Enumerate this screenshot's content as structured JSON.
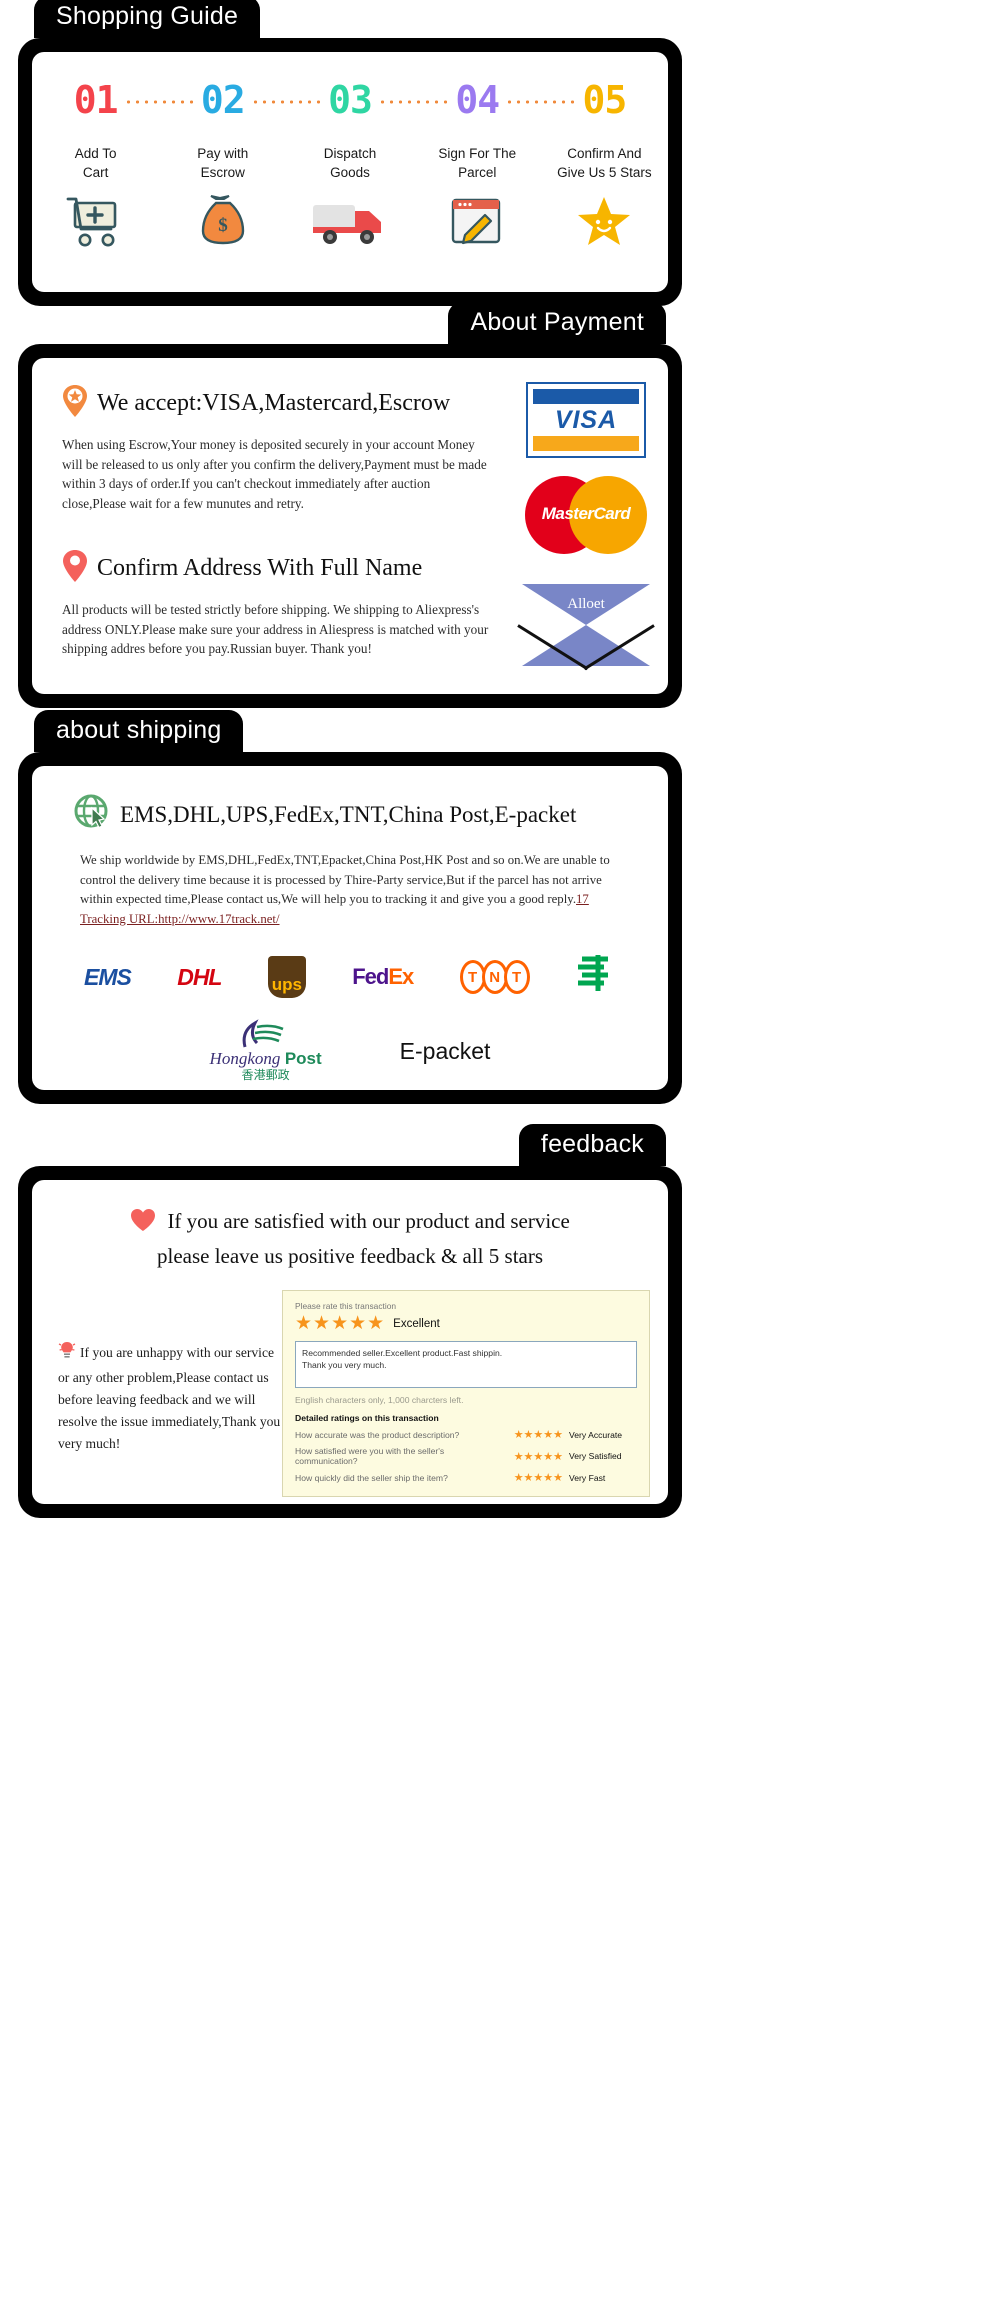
{
  "sections": {
    "guide": {
      "tab": "Shopping Guide",
      "steps": [
        {
          "num": "01",
          "color": "#f4434b",
          "label": "Add To\nCart",
          "icon": "shopping-cart-icon"
        },
        {
          "num": "02",
          "color": "#29abe2",
          "label": "Pay with\nEscrow",
          "icon": "money-bag-icon"
        },
        {
          "num": "03",
          "color": "#2fd6a3",
          "label": "Dispatch\nGoods",
          "icon": "delivery-truck-icon"
        },
        {
          "num": "04",
          "color": "#9b7af0",
          "label": "Sign For The\nParcel",
          "icon": "sign-document-icon"
        },
        {
          "num": "05",
          "color": "#f7b500",
          "label": "Confirm And\nGive Us 5 Stars",
          "icon": "smiling-star-icon"
        }
      ]
    },
    "payment": {
      "tab": "About Payment",
      "heading1": "We accept:VISA,Mastercard,Escrow",
      "heading1_icon": "star-pin-icon",
      "body1": "When using Escrow,Your money is deposited securely in your account Money will be released to us only after you confirm the delivery,Payment must be made within 3 days of order.If you can't checkout immediately after auction close,Please wait for a few munutes and retry.",
      "heading2": "Confirm Address With Full Name",
      "heading2_icon": "map-pin-icon",
      "body2": "All products will be tested strictly before shipping. We shipping to Aliexpress's address ONLY.Please make sure your address in Aliespress is matched with your shipping addres before you pay.Russian buyer. Thank you!",
      "logos": {
        "visa": "VISA",
        "mastercard": "MasterCard",
        "envelope_text": "Alloet"
      }
    },
    "shipping": {
      "tab": "about shipping",
      "heading": "EMS,DHL,UPS,FedEx,TNT,China Post,E-packet",
      "heading_icon": "globe-cursor-icon",
      "body": "We ship worldwide by EMS,DHL,FedEx,TNT,Epacket,China Post,HK Post and so on.We are unable to control the delivery time because it is processed by Thire-Party service,But if the parcel has not arrive within expected time,Please contact us,We will help you to tracking it and give you a good reply.",
      "tracking_label": "17 Tracking URL:http://www.17track.net/",
      "couriers_row1": [
        "EMS",
        "DHL",
        "ups",
        "FedEx",
        "TNT",
        "China Post"
      ],
      "couriers_row2": [
        "Hongkong Post",
        "E-packet"
      ],
      "hkpost": {
        "italic": "Hongkong",
        "bold": "Post",
        "cn": "香港郵政"
      },
      "fedex": {
        "part1": "Fed",
        "part2": "Ex"
      },
      "tnt_letters": [
        "T",
        "N",
        "T"
      ],
      "epacket": "E-packet"
    },
    "feedback": {
      "tab": "feedback",
      "heading_line1": "If you are satisfied with our product and service",
      "heading_line2": "please leave us positive feedback & all 5 stars",
      "heading_icon": "heart-icon",
      "left_icon": "lightbulb-icon",
      "left_text": "If you are unhappy with our service or any other problem,Please contact us before leaving feedback and we will resolve the issue immediately,Thank you very much!",
      "rate_card": {
        "prompt": "Please rate this transaction",
        "stars": "★★★★★",
        "rating_label": "Excellent",
        "review_line1": "Recommended seller.Excellent product.Fast shippin.",
        "review_line2": "Thank you very much.",
        "char_note": "English characters only, 1,000 charcters left.",
        "detail_title": "Detailed ratings on this transaction",
        "rows": [
          {
            "question": "How accurate was the product description?",
            "stars": "★★★★★",
            "value": "Very Accurate"
          },
          {
            "question": "How satisfied were you with the seller's communication?",
            "stars": "★★★★★",
            "value": "Very Satisfied"
          },
          {
            "question": "How quickly did the seller ship the item?",
            "stars": "★★★★★",
            "value": "Very Fast"
          }
        ]
      }
    }
  },
  "colors": {
    "accent_orange": "#f7941d",
    "panel_black": "#000000",
    "dot_orange": "#f08a3c",
    "link_red": "#7a1f1f"
  }
}
